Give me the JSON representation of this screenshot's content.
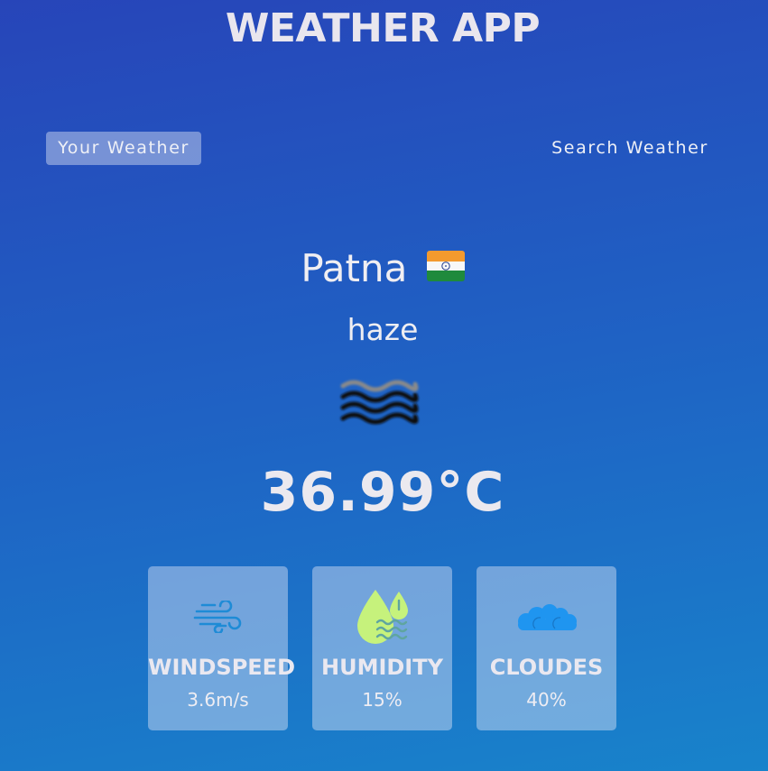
{
  "header": {
    "title": "WEATHER APP"
  },
  "tabs": [
    {
      "label": "Your Weather",
      "active": true
    },
    {
      "label": "Search Weather",
      "active": false
    }
  ],
  "weather": {
    "city": "Patna",
    "country_flag_icon": "india-flag-icon",
    "condition": "haze",
    "condition_icon": "haze-icon",
    "temperature": "36.99°C"
  },
  "stats": [
    {
      "label": "WINDSPEED",
      "value": "3.6m/s",
      "icon": "wind-icon"
    },
    {
      "label": "HUMIDITY",
      "value": "15%",
      "icon": "humidity-icon"
    },
    {
      "label": "CLOUDES",
      "value": "40%",
      "icon": "cloud-icon"
    }
  ],
  "colors": {
    "background_top": "#2745b9",
    "background_bottom": "#1883cb",
    "active_tab_bg": "rgba(255,255,255,0.38)",
    "card_bg": "rgba(235,235,250,0.42)",
    "humidity_icon": "#c6f27c",
    "wind_icon": "#1e8bd6",
    "cloud_icon": "#1f95f0"
  }
}
